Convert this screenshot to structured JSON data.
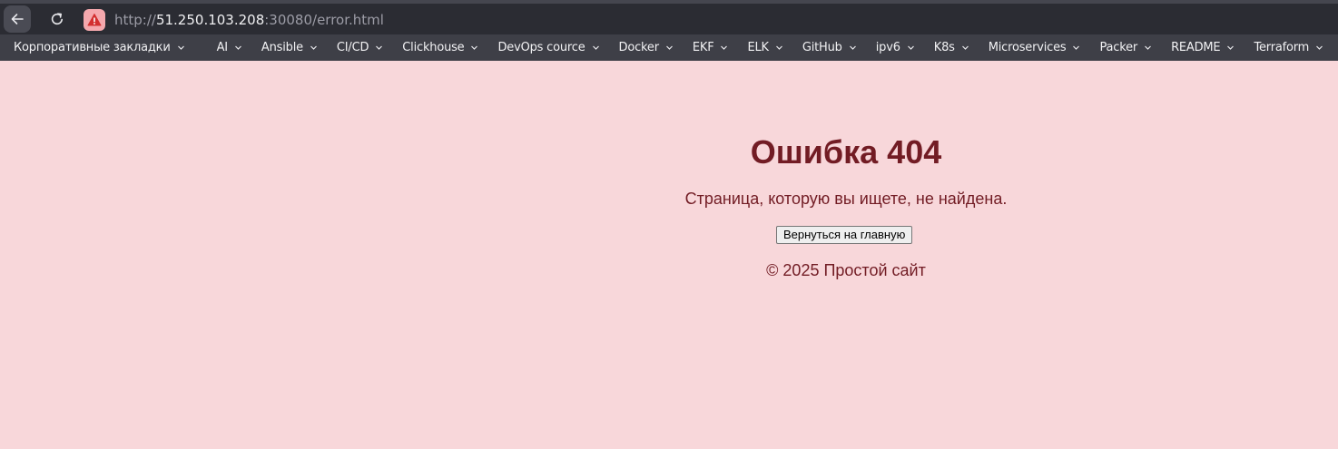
{
  "browser": {
    "url_scheme": "http://",
    "url_host": "51.250.103.208",
    "url_rest": ":30080/error.html",
    "icons": {
      "back": "arrow-left-icon",
      "reload": "reload-icon",
      "security": "warning-triangle-icon"
    },
    "colors": {
      "toolbar": "#2b2c33",
      "bookmarks_bar": "#3e3f47",
      "warning_badge": "#f5a8ad",
      "warning_icon": "#d32f2f"
    }
  },
  "bookmarks": [
    {
      "label": "Корпоративные закладки"
    },
    {
      "label": "AI"
    },
    {
      "label": "Ansible"
    },
    {
      "label": "CI/CD"
    },
    {
      "label": "Clickhouse"
    },
    {
      "label": "DevOps cource"
    },
    {
      "label": "Docker"
    },
    {
      "label": "EKF"
    },
    {
      "label": "ELK"
    },
    {
      "label": "GitHub"
    },
    {
      "label": "ipv6"
    },
    {
      "label": "K8s"
    },
    {
      "label": "Microservices"
    },
    {
      "label": "Packer"
    },
    {
      "label": "README"
    },
    {
      "label": "Terraform"
    }
  ],
  "page": {
    "title": "Ошибка 404",
    "message": "Страница, которую вы ищете, не найдена.",
    "home_button": "Вернуться на главную",
    "footer": "© 2025 Простой сайт",
    "colors": {
      "background": "#f8d7da",
      "text": "#721c24"
    }
  }
}
